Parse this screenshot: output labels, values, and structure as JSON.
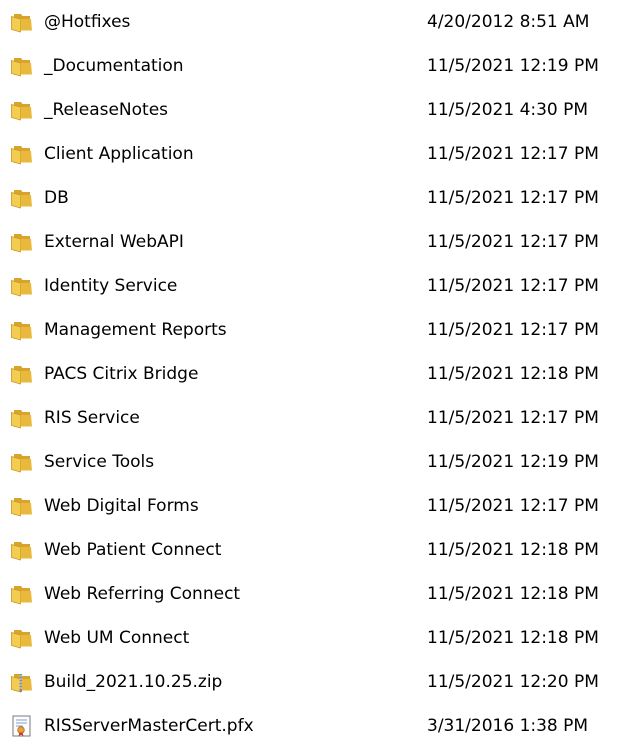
{
  "files": [
    {
      "name": "@Hotfixes",
      "modified": "4/20/2012 8:51 AM",
      "icon": "folder-icon"
    },
    {
      "name": "_Documentation",
      "modified": "11/5/2021 12:19 PM",
      "icon": "folder-icon"
    },
    {
      "name": "_ReleaseNotes",
      "modified": "11/5/2021 4:30 PM",
      "icon": "folder-icon"
    },
    {
      "name": "Client Application",
      "modified": "11/5/2021 12:17 PM",
      "icon": "folder-icon"
    },
    {
      "name": "DB",
      "modified": "11/5/2021 12:17 PM",
      "icon": "folder-icon"
    },
    {
      "name": "External WebAPI",
      "modified": "11/5/2021 12:17 PM",
      "icon": "folder-icon"
    },
    {
      "name": "Identity Service",
      "modified": "11/5/2021 12:17 PM",
      "icon": "folder-icon"
    },
    {
      "name": "Management Reports",
      "modified": "11/5/2021 12:17 PM",
      "icon": "folder-icon"
    },
    {
      "name": "PACS Citrix Bridge",
      "modified": "11/5/2021 12:18 PM",
      "icon": "folder-icon"
    },
    {
      "name": "RIS Service",
      "modified": "11/5/2021 12:17 PM",
      "icon": "folder-icon"
    },
    {
      "name": "Service Tools",
      "modified": "11/5/2021 12:19 PM",
      "icon": "folder-icon"
    },
    {
      "name": "Web Digital Forms",
      "modified": "11/5/2021 12:17 PM",
      "icon": "folder-icon"
    },
    {
      "name": "Web Patient Connect",
      "modified": "11/5/2021 12:18 PM",
      "icon": "folder-icon"
    },
    {
      "name": "Web Referring Connect",
      "modified": "11/5/2021 12:18 PM",
      "icon": "folder-icon"
    },
    {
      "name": "Web UM Connect",
      "modified": "11/5/2021 12:18 PM",
      "icon": "folder-icon"
    },
    {
      "name": "Build_2021.10.25.zip",
      "modified": "11/5/2021 12:20 PM",
      "icon": "zip-folder-icon"
    },
    {
      "name": "RISServerMasterCert.pfx",
      "modified": "3/31/2016 1:38 PM",
      "icon": "certificate-icon"
    }
  ]
}
